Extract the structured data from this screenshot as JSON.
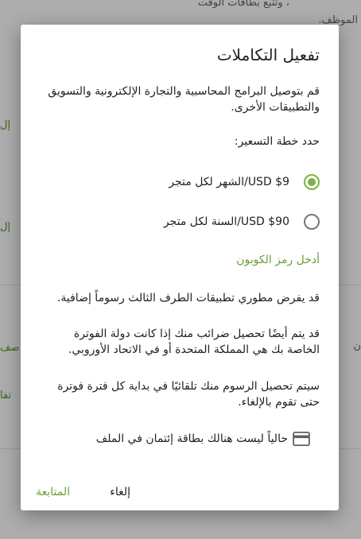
{
  "background": {
    "line1": "، وتتبع بطاقات الوقت",
    "line2": "الموظف.",
    "link_a": "إل",
    "link_b": "إل",
    "side_text_a": "صف",
    "side_text_b": "تفا",
    "side_text_c": "ن"
  },
  "dialog": {
    "title": "تفعيل التكاملات",
    "intro": "قم بتوصيل البرامج المحاسبية والتجارة الإلكترونية والتسويق والتطبيقات الأخرى.",
    "pricing_prompt": "حدد خطة التسعير:",
    "plans": [
      {
        "label": "USD $9/الشهر لكل متجر",
        "selected": true
      },
      {
        "label": "USD $90/السنة لكل متجر",
        "selected": false
      }
    ],
    "coupon_link": "أدخل رمز الكوبون",
    "notice_third_party": "قد يفرض مطوري تطبيقات الطرف الثالث رسوماً إضافية.",
    "notice_tax": "قد يتم أيضًا تحصيل ضرائب منك إذا كانت دولة الفوترة الخاصة بك هي المملكة المتحدة أو في الاتحاد الأوروبي.",
    "notice_billing": "سيتم تحصيل الرسوم منك تلقائيًا في بداية كل فترة فوترة حتى تقوم بالإلغاء.",
    "card_icon": "credit-card-icon",
    "card_status": "حالياً ليست هنالك بطاقة إئتمان في الملف",
    "cancel_label": "إلغاء",
    "continue_label": "المتابعة"
  },
  "colors": {
    "accent": "#7cb342",
    "link": "#689f38",
    "scrim": "rgba(0,0,0,0.32)"
  }
}
